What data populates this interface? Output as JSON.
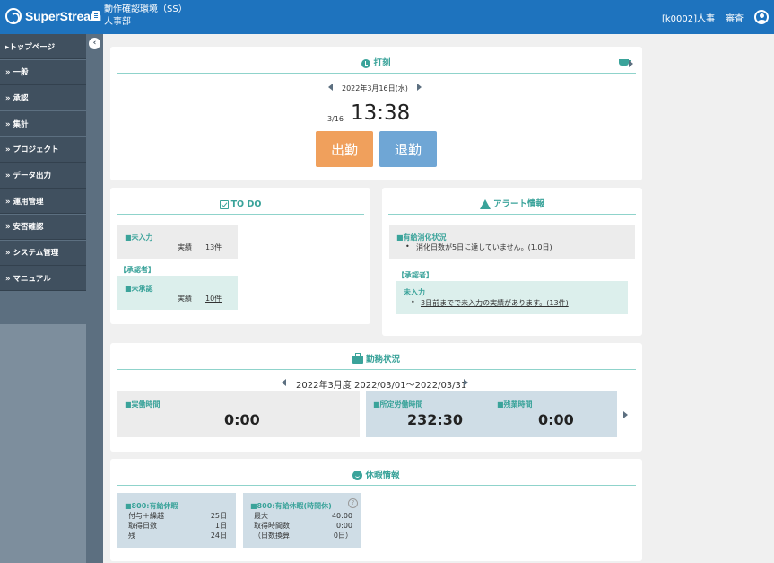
{
  "header": {
    "brand": "SuperStream",
    "env_line1": "動作確認環境（SS）",
    "env_line2": "人事部",
    "user": "[k0002]人事",
    "role": "審査"
  },
  "sidebar": {
    "collapse_glyph": "‹",
    "items": [
      {
        "label": "▸トップページ"
      },
      {
        "label": "» 一般"
      },
      {
        "label": "» 承認"
      },
      {
        "label": "» 集計"
      },
      {
        "label": "» プロジェクト"
      },
      {
        "label": "» データ出力"
      },
      {
        "label": "» 運用管理"
      },
      {
        "label": "» 安否確認"
      },
      {
        "label": "» システム管理"
      },
      {
        "label": "» マニュアル"
      }
    ]
  },
  "punch": {
    "title": "打刻",
    "date": "2022年3月16日(水)",
    "small_date": "3/16",
    "time": "13:38",
    "clock_in": "出勤",
    "clock_out": "退勤",
    "colors": {
      "clock_in": "#f0a05c",
      "clock_out": "#6fa6d5"
    }
  },
  "todo": {
    "title": "TO DO",
    "unentered_label": "■未入力",
    "unentered_key": "実績",
    "unentered_val": "13件",
    "approver": "【承認者】",
    "unapproved_label": "■未承認",
    "unapproved_key": "実績",
    "unapproved_val": "10件"
  },
  "alert": {
    "title": "アラート情報",
    "paid_leave_label": "■有給消化状況",
    "paid_leave_msg": "消化日数が5日に達していません。(1.0日)",
    "approver": "【承認者】",
    "unentered_label": "未入力",
    "unentered_msg": "3日前までで未入力の実績があります。(13件)"
  },
  "work": {
    "title": "勤務状況",
    "period": "2022年3月度  2022/03/01～2022/03/31",
    "actual_label": "■実働時間",
    "actual_value": "0:00",
    "scheduled_label": "■所定労働時間",
    "scheduled_value": "232:30",
    "overtime_label": "■残業時間",
    "overtime_value": "0:00"
  },
  "leave": {
    "title": "休暇情報",
    "paid": {
      "label": "■800:有給休暇",
      "rows": [
        {
          "k": "付与＋繰越",
          "v": "25日"
        },
        {
          "k": "取得日数",
          "v": "1日"
        },
        {
          "k": "残",
          "v": "24日"
        }
      ]
    },
    "hourly": {
      "label": "■800:有給休暇(時間休)",
      "help": "?",
      "rows": [
        {
          "k": "最大",
          "v": "40:00"
        },
        {
          "k": "取得時間数",
          "v": "0:00"
        },
        {
          "k": "（日数換算",
          "v": "0日）"
        }
      ]
    }
  }
}
